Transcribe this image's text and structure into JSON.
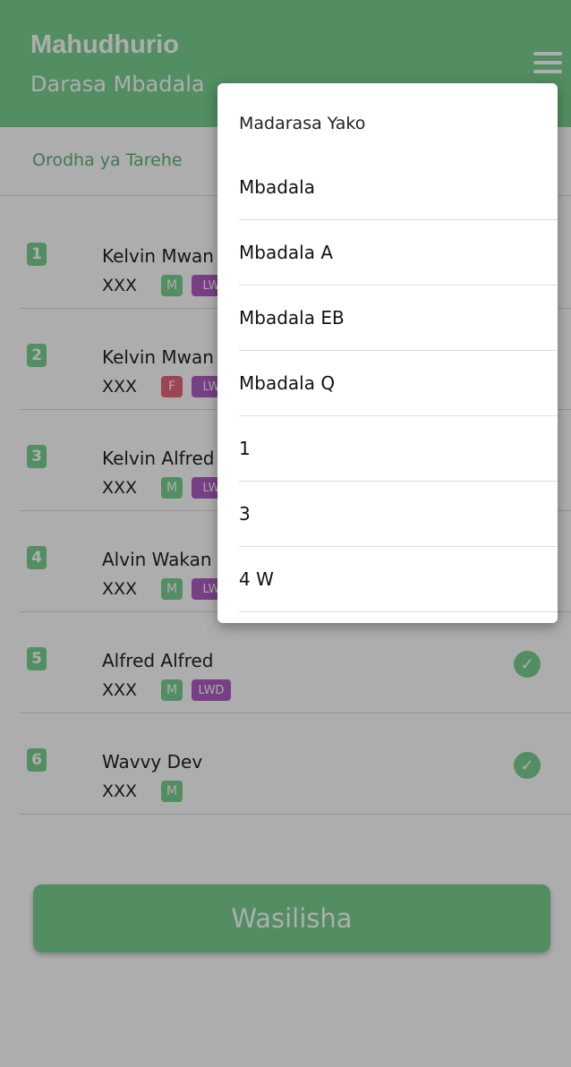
{
  "header": {
    "title": "Mahudhurio",
    "subtitle": "Darasa Mbadala"
  },
  "subbar": {
    "tab_label": "Orodha ya Tarehe"
  },
  "students": [
    {
      "number": "1",
      "name": "Kelvin Mwan",
      "code": "XXX",
      "gender": "M",
      "tag": "LW"
    },
    {
      "number": "2",
      "name": "Kelvin Mwan",
      "code": "XXX",
      "gender": "F",
      "tag": "LW"
    },
    {
      "number": "3",
      "name": "Kelvin Alfred",
      "code": "XXX",
      "gender": "M",
      "tag": "LW"
    },
    {
      "number": "4",
      "name": "Alvin Wakan",
      "code": "XXX",
      "gender": "M",
      "tag": "LW"
    },
    {
      "number": "5",
      "name": "Alfred Alfred",
      "code": "XXX",
      "gender": "M",
      "tag": "LWD"
    },
    {
      "number": "6",
      "name": "Wavvy Dev",
      "code": "XXX",
      "gender": "M",
      "tag": ""
    }
  ],
  "submit_label": "Wasilisha",
  "dropdown": {
    "header": "Madarasa Yako",
    "items": [
      "Mbadala",
      "Mbadala A",
      "Mbadala EB",
      "Mbadala Q",
      "1",
      "3",
      "4 W"
    ]
  },
  "colors": {
    "primary": "#7ad291",
    "female_badge": "#e8667a",
    "lwd_badge": "#b05fc4"
  },
  "icons": {
    "menu": "hamburger-menu-icon",
    "check": "check-circle-icon"
  }
}
